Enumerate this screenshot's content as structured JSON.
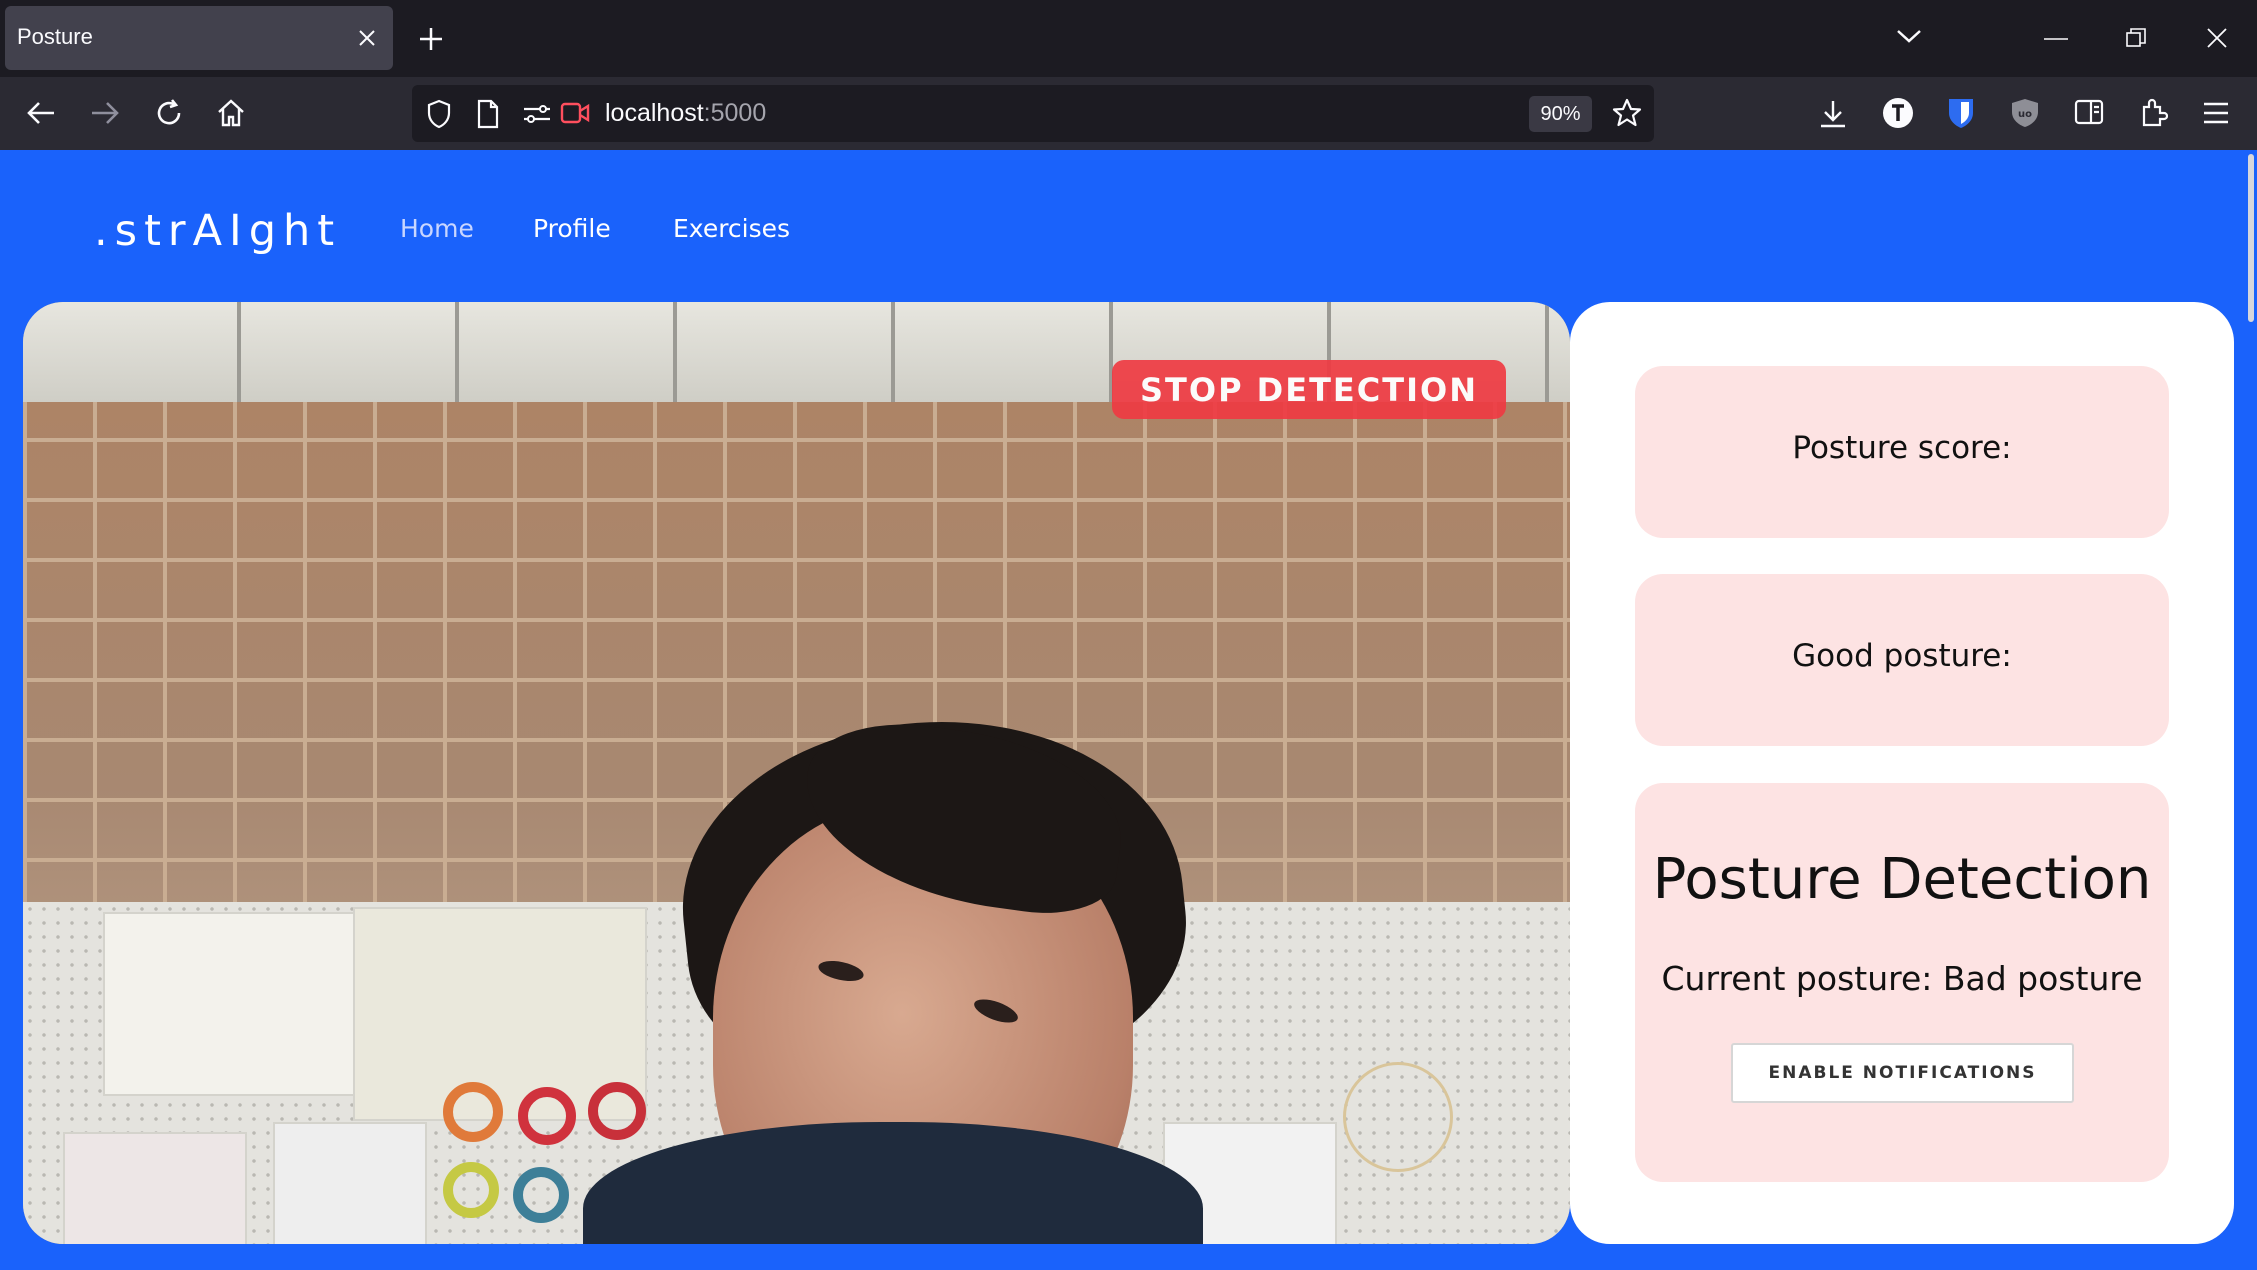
{
  "browser": {
    "tab_title": "Posture",
    "url_host": "localhost",
    "url_port": ":5000",
    "zoom": "90%"
  },
  "icons": {
    "tab_close": "close-icon",
    "new_tab": "plus-icon",
    "tab_list": "chevron-down-icon",
    "minimize": "minimize-icon",
    "restore": "restore-icon",
    "window_close": "close-icon",
    "back": "back-arrow-icon",
    "forward": "forward-arrow-icon",
    "reload": "reload-icon",
    "home": "home-icon",
    "shield": "shield-icon",
    "page": "page-icon",
    "permissions": "permissions-icon",
    "camera": "camera-icon",
    "bookmark": "star-icon",
    "downloads": "download-icon",
    "extension_t": "extension-t-icon",
    "bitwarden": "shield-extension-icon",
    "ublock": "ublock-icon",
    "sidebar": "sidebar-icon",
    "extensions": "puzzle-icon",
    "menu": "hamburger-menu-icon"
  },
  "site": {
    "brand": ".strAIght",
    "nav": [
      {
        "label": "Home",
        "active": true
      },
      {
        "label": "Profile",
        "active": false
      },
      {
        "label": "Exercises",
        "active": false
      }
    ]
  },
  "camera": {
    "stop_label": "STOP DETECTION"
  },
  "panel": {
    "posture_score_label": "Posture score:",
    "good_posture_label": "Good posture:",
    "detection_title": "Posture Detection",
    "current_posture": "Current posture: Bad posture",
    "notify_label": "ENABLE NOTIFICATIONS"
  },
  "colors": {
    "page_bg": "#1a62fb",
    "card_bg": "#fde3e3",
    "stop_button": "#ef3b43"
  }
}
